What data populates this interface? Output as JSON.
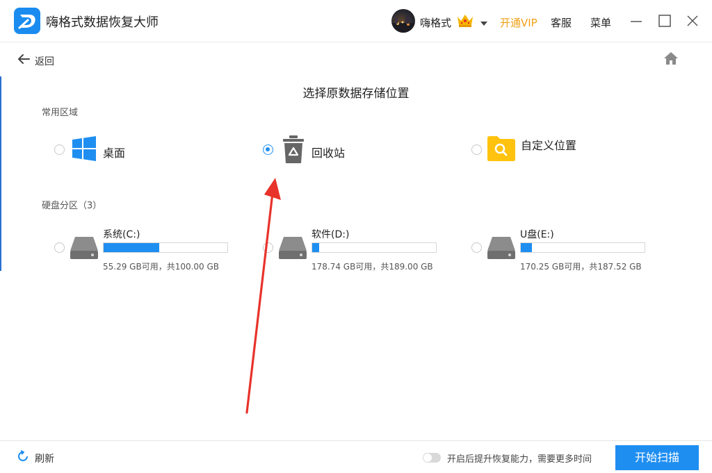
{
  "app": {
    "title": "嗨格式数据恢复大师"
  },
  "header": {
    "username": "嗨格式",
    "vip_label": "开通VIP",
    "service_label": "客服",
    "menu_label": "菜单"
  },
  "nav": {
    "back_label": "返回"
  },
  "page": {
    "title": "选择原数据存储位置"
  },
  "common_area": {
    "label": "常用区域",
    "items": [
      {
        "label": "桌面",
        "selected": false,
        "icon": "windows-icon"
      },
      {
        "label": "回收站",
        "selected": true,
        "icon": "recycle-bin-icon"
      },
      {
        "label": "自定义位置",
        "selected": false,
        "icon": "folder-search-icon"
      }
    ]
  },
  "disk_area": {
    "label": "硬盘分区（3）",
    "drives": [
      {
        "name": "系统(C:)",
        "info": "55.29 GB可用，共100.00 GB",
        "used_fraction": 0.447
      },
      {
        "name": "软件(D:)",
        "info": "178.74 GB可用，共189.00 GB",
        "used_fraction": 0.054
      },
      {
        "name": "U盘(E:)",
        "info": "170.25 GB可用，共187.52 GB",
        "used_fraction": 0.092
      }
    ]
  },
  "footer": {
    "refresh_label": "刷新",
    "toggle_label": "开启后提升恢复能力，需要更多时间",
    "toggle_on": false,
    "scan_label": "开始扫描"
  },
  "colors": {
    "accent": "#1f8ef1",
    "vip": "#f0a017",
    "annotation": "#e8332b",
    "folder": "#ffc20e"
  }
}
